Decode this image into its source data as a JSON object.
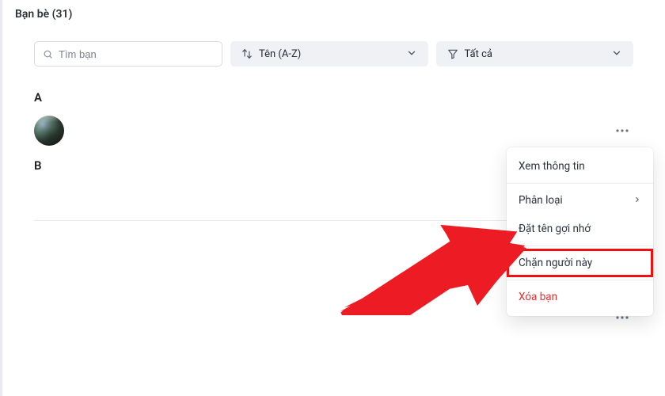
{
  "header": {
    "title": "Bạn bè (31)"
  },
  "search": {
    "placeholder": "Tìm bạn"
  },
  "sort": {
    "label": "Tên (A-Z)"
  },
  "filter": {
    "label": "Tất cả"
  },
  "sections": {
    "a": "A",
    "b": "B"
  },
  "menu": {
    "view_info": "Xem thông tin",
    "categorize": "Phân loại",
    "set_nickname": "Đặt tên gợi nhớ",
    "block": "Chặn người này",
    "unfriend": "Xóa bạn"
  }
}
